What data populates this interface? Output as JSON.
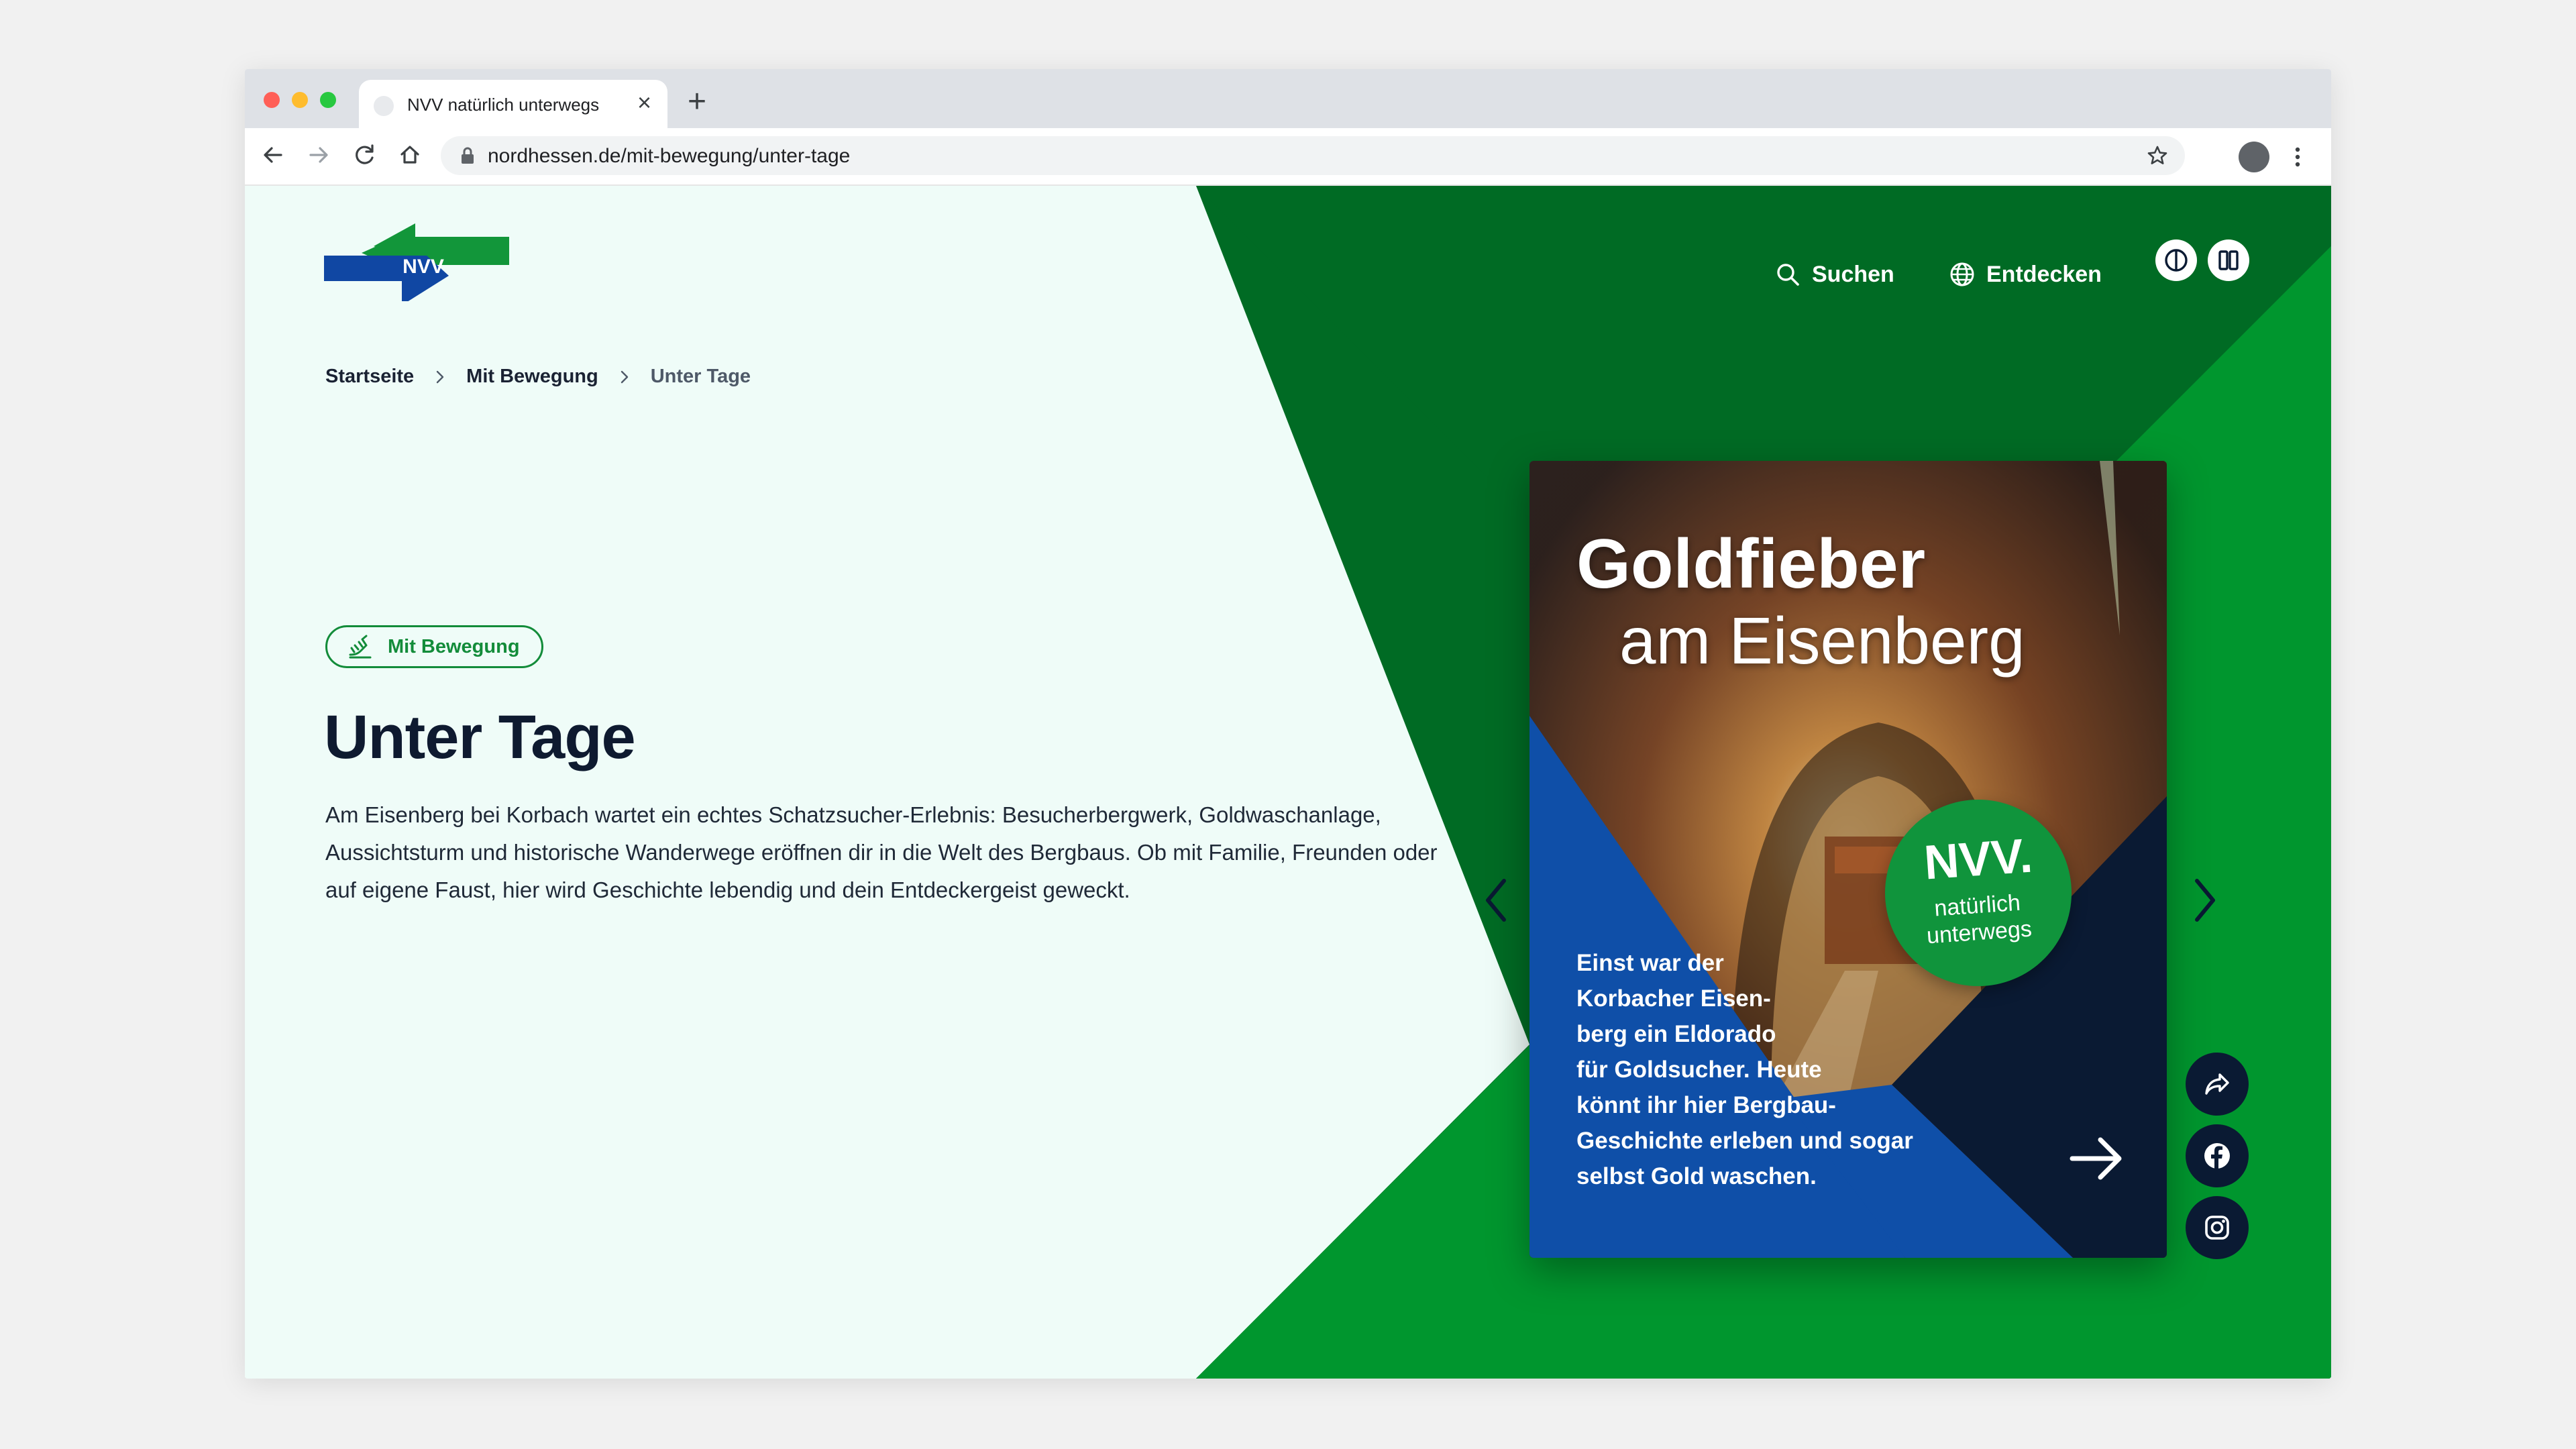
{
  "browser": {
    "tab_title": "NVV natürlich unterwegs",
    "tab_close_glyph": "×",
    "new_tab_glyph": "+",
    "url": "nordhessen.de/mit-bewegung/unter-tage",
    "traffic_lights": [
      "#ff5f57",
      "#febc2e",
      "#28c840"
    ]
  },
  "site": {
    "logo_text": "NVV",
    "nav": [
      {
        "label": "Suchen",
        "icon": "search-icon"
      },
      {
        "label": "Entdecken",
        "icon": "globe-icon"
      }
    ],
    "accessibility_buttons": [
      {
        "icon": "contrast-icon"
      },
      {
        "icon": "book-icon"
      }
    ]
  },
  "breadcrumb": [
    "Startseite",
    "Mit Bewegung",
    "Unter Tage"
  ],
  "category_pill": "Mit Bewegung",
  "page_title": "Unter Tage",
  "intro": "Am Eisenberg bei Korbach wartet ein echtes Schatzsucher-Erlebnis: Besucherbergwerk, Goldwaschanlage, Aussichtsturm und historische Wanderwege eröffnen dir in die Welt des Bergbaus. Ob mit Familie, Freunden oder auf eigene Faust, hier wird Geschichte lebendig und dein Entdeckergeist geweckt.",
  "card": {
    "headline_1": "Goldfieber",
    "headline_2": "am Eisenberg",
    "badge_top": "NVV.",
    "badge_line_1": "natürlich",
    "badge_line_2": "unterwegs",
    "text_lines": [
      "Einst war der",
      "Korbacher Eisen-",
      "berg ein Eldorado",
      "für Goldsucher. Heute",
      "könnt ihr hier Bergbau-",
      "Geschichte erleben und sogar",
      "selbst Gold waschen."
    ]
  },
  "social": [
    "share-icon",
    "facebook-icon",
    "instagram-icon"
  ],
  "colors": {
    "page_bg": "#effcf8",
    "green_dark": "#006b24",
    "green": "#00962e",
    "navy": "#0a1a33",
    "blue": "#0f4fa8",
    "text": "#0e1a30"
  }
}
